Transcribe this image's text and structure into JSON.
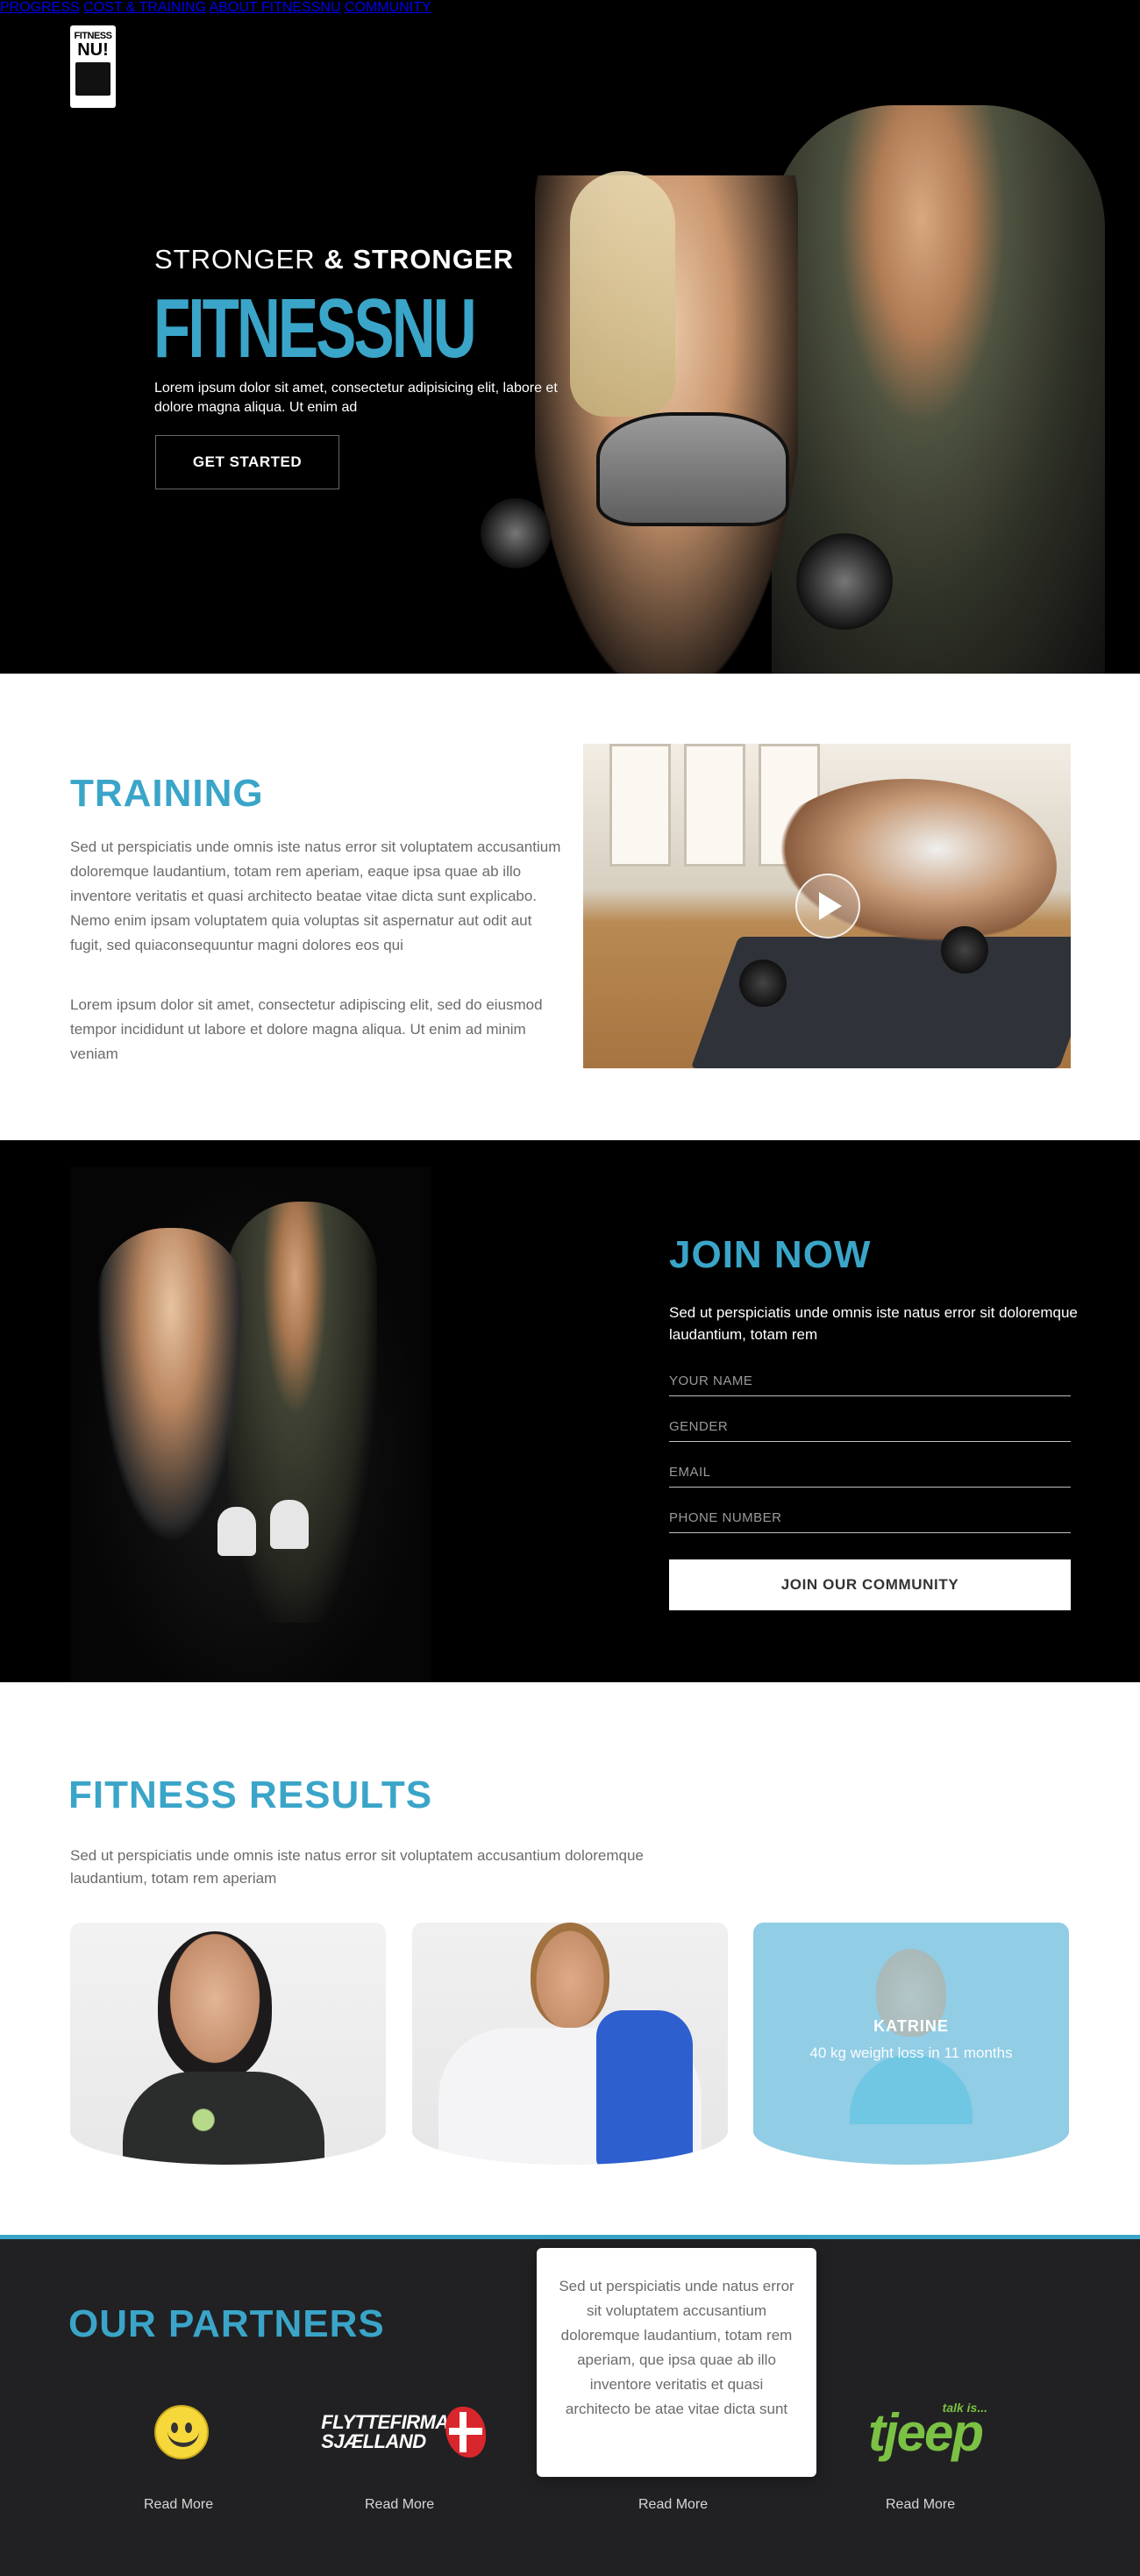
{
  "brand": {
    "logo_line1": "FITNESS",
    "logo_line2": "NU!"
  },
  "nav": {
    "items": [
      {
        "label": "PROGRESS"
      },
      {
        "label": "COST & TRAINING"
      },
      {
        "label": "ABOUT FITNESSNU"
      },
      {
        "label": "COMMUNITY"
      }
    ],
    "active": "PROGRESS"
  },
  "hero": {
    "subtitle_light": "STRONGER",
    "subtitle_bold": "& STRONGER",
    "title": "FITNESSNU",
    "description": "Lorem ipsum dolor sit amet, consectetur adipisicing elit, labore et dolore magna aliqua. Ut enim ad",
    "cta": "GET STARTED"
  },
  "training": {
    "title": "TRAINING",
    "paragraph1": "Sed ut perspiciatis unde omnis iste natus error sit voluptatem accusantium doloremque laudantium, totam rem aperiam, eaque ipsa quae ab illo inventore veritatis et quasi architecto beatae vitae dicta sunt explicabo. Nemo enim ipsam voluptatem quia voluptas sit aspernatur aut odit aut fugit, sed quiaconsequuntur magni dolores eos qui",
    "paragraph2": "Lorem ipsum dolor sit amet, consectetur adipiscing elit, sed do eiusmod tempor incididunt ut labore et dolore magna aliqua. Ut enim ad minim veniam"
  },
  "join": {
    "title": "JOIN NOW",
    "description": "Sed ut perspiciatis unde omnis iste natus error sit doloremque laudantium, totam rem",
    "fields": {
      "name": "YOUR NAME",
      "gender": "GENDER",
      "email": "EMAIL",
      "phone": "PHONE NUMBER"
    },
    "submit": "JOIN OUR COMMUNITY"
  },
  "results": {
    "title": "FITNESS RESULTS",
    "description": "Sed ut perspiciatis unde omnis iste natus error sit voluptatem accusantium doloremque laudantium, totam rem aperiam",
    "cards": [
      {
        "name": "",
        "meta": ""
      },
      {
        "name": "",
        "meta": ""
      },
      {
        "name": "KATRINE",
        "meta": "40 kg weight loss in 11 months"
      }
    ]
  },
  "partners": {
    "title": "OUR PARTNERS",
    "logos": [
      {
        "icon": "smiley-logo",
        "text": ""
      },
      {
        "icon": "flyttefirma-logo",
        "text_line1": "FLYTTEFIRMA",
        "text_line2": "SJÆLLAND"
      },
      {
        "icon": "hidden-logo",
        "text": ""
      },
      {
        "icon": "tjeep-logo",
        "text": "tjeep",
        "tagline": "talk is..."
      }
    ],
    "read_more": "Read More",
    "popup_text": "Sed ut perspiciatis unde natus error sit voluptatem accusantium doloremque laudantium, totam rem aperiam, que ipsa quae ab illo inventore veritatis et quasi architecto be atae vitae dicta sunt"
  },
  "colors": {
    "accent": "#3aa5c8",
    "dark": "#000000",
    "footer": "#212123"
  }
}
